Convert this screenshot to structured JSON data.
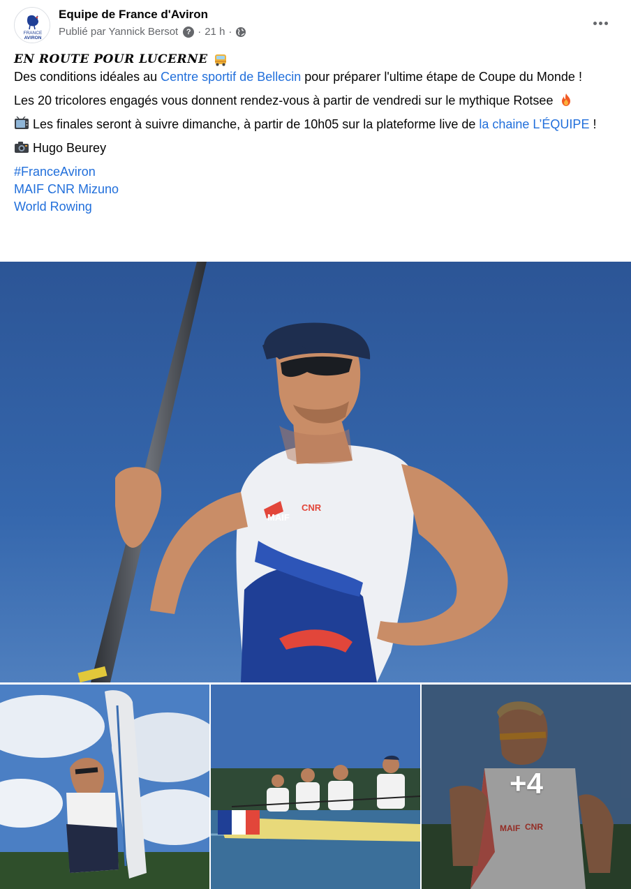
{
  "header": {
    "page_name": "Equipe de France d'Aviron",
    "published_by": "Publié par Yannick Bersot",
    "help_glyph": "?",
    "separator": "·",
    "time": "21 h",
    "privacy_icon": "globe-icon",
    "avatar_text_1": "FRANCE",
    "avatar_text_2": "AVIRON"
  },
  "post": {
    "title": "EN ROUTE POUR LUCERNE",
    "title_emoji": "bus-emoji",
    "p1_before": "Des conditions idéales au ",
    "p1_link": "Centre sportif de Bellecin",
    "p1_after": " pour préparer l'ultime étape de Coupe du Monde !",
    "p2": "Les 20 tricolores engagés vous donnent rendez-vous à partir de vendredi sur le mythique Rotsee",
    "p2_emoji": "fire-emoji",
    "p3_emoji": "tv-emoji",
    "p3_before": " Les finales seront à suivre dimanche, à partir de 10h05 sur la plateforme live de ",
    "p3_link": "la chaine L’ÉQUIPE",
    "p3_after": " !",
    "p4_emoji": "camera-emoji",
    "p4": " Hugo Beurey",
    "hashtag": "#FranceAviron",
    "tags_line": "MAIF CNR Mizuno",
    "tag_world": "World Rowing"
  },
  "photos": {
    "more_count": "+4",
    "jersey_maif": "MAIF",
    "jersey_cnr": "CNR"
  },
  "colors": {
    "link": "#216fdb",
    "secondary_text": "#65676b",
    "sky": "#2f5ea3",
    "france_blue": "#1f3f96",
    "france_red": "#e2463a"
  }
}
